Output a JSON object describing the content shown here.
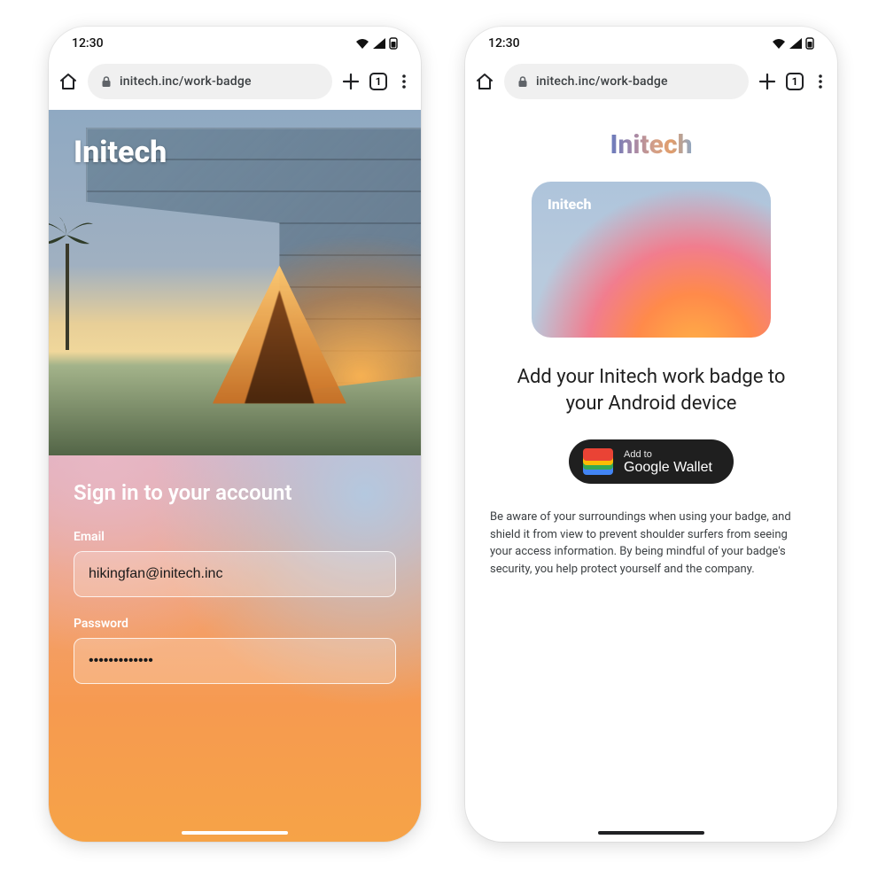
{
  "status": {
    "time": "12:30"
  },
  "chrome": {
    "url": "initech.inc/work-badge",
    "tab_count": "1"
  },
  "left": {
    "brand": "Initech",
    "heading": "Sign in to your account",
    "email_label": "Email",
    "email_value": "hikingfan@initech.inc",
    "password_label": "Password",
    "password_value": "•••••••••••••"
  },
  "right": {
    "brand": "Initech",
    "card_brand": "Initech",
    "title": "Add your Initech work badge to your Android device",
    "wallet_small": "Add to",
    "wallet_large": "Google Wallet",
    "disclaimer": "Be aware of your surroundings when using your badge, and shield it from view to prevent shoulder surfers from seeing your access information.  By being mindful of your badge's security, you help protect yourself and the company."
  }
}
